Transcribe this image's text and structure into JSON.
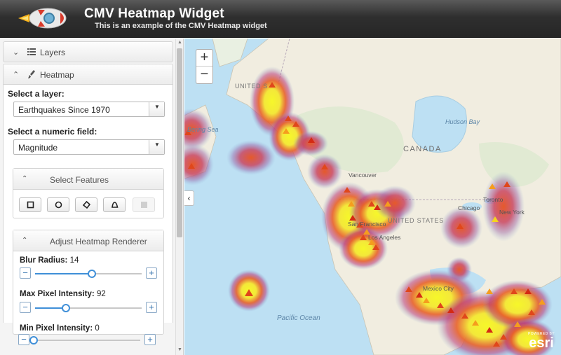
{
  "header": {
    "title": "CMV Heatmap Widget",
    "subtitle": "This is an example of the CMV Heatmap widget"
  },
  "sidebar": {
    "layers_panel": {
      "label": "Layers",
      "icon": "list-icon"
    },
    "heatmap_panel": {
      "label": "Heatmap",
      "icon": "paint-brush-icon",
      "select_layer_label": "Select a layer:",
      "selected_layer": "Earthquakes Since 1970",
      "select_field_label": "Select a numeric field:",
      "selected_field": "Magnitude",
      "select_features": {
        "label": "Select Features",
        "tools": [
          "square-tool-icon",
          "circle-tool-icon",
          "polygon-tool-icon",
          "freehand-tool-icon",
          "disabled-tool"
        ]
      },
      "renderer": {
        "label": "Adjust Heatmap Renderer",
        "blur_radius": {
          "label": "Blur Radius:",
          "value": "14",
          "fraction": 0.53
        },
        "max_pixel": {
          "label": "Max Pixel Intensity:",
          "value": "92",
          "fraction": 0.29
        },
        "min_pixel": {
          "label": "Min Pixel Intensity:",
          "value": "0",
          "fraction": 0.0
        }
      }
    }
  },
  "map": {
    "zoom_in": "+",
    "zoom_out": "−",
    "collapse": "‹",
    "attribution_small": "POWERED BY",
    "attribution_logo": "esri",
    "labels": [
      {
        "text": "UNITED STATES",
        "short": "UNITED S"
      },
      {
        "text": "CANADA"
      },
      {
        "text": "Hudson Bay"
      },
      {
        "text": "Vancouver"
      },
      {
        "text": "Chicago"
      },
      {
        "text": "Toronto"
      },
      {
        "text": "New York"
      },
      {
        "text": "UNITED STATES"
      },
      {
        "text": "Los Angeles"
      },
      {
        "text": "Mexico City"
      },
      {
        "text": "Pacific Ocean"
      },
      {
        "text": "Bering Sea"
      },
      {
        "text": "San Francisco"
      }
    ]
  },
  "colors": {
    "accent": "#3f8fd8",
    "header_bg": "#2f2f2f",
    "water": "#bde0f3",
    "land": "#f1ede0"
  }
}
